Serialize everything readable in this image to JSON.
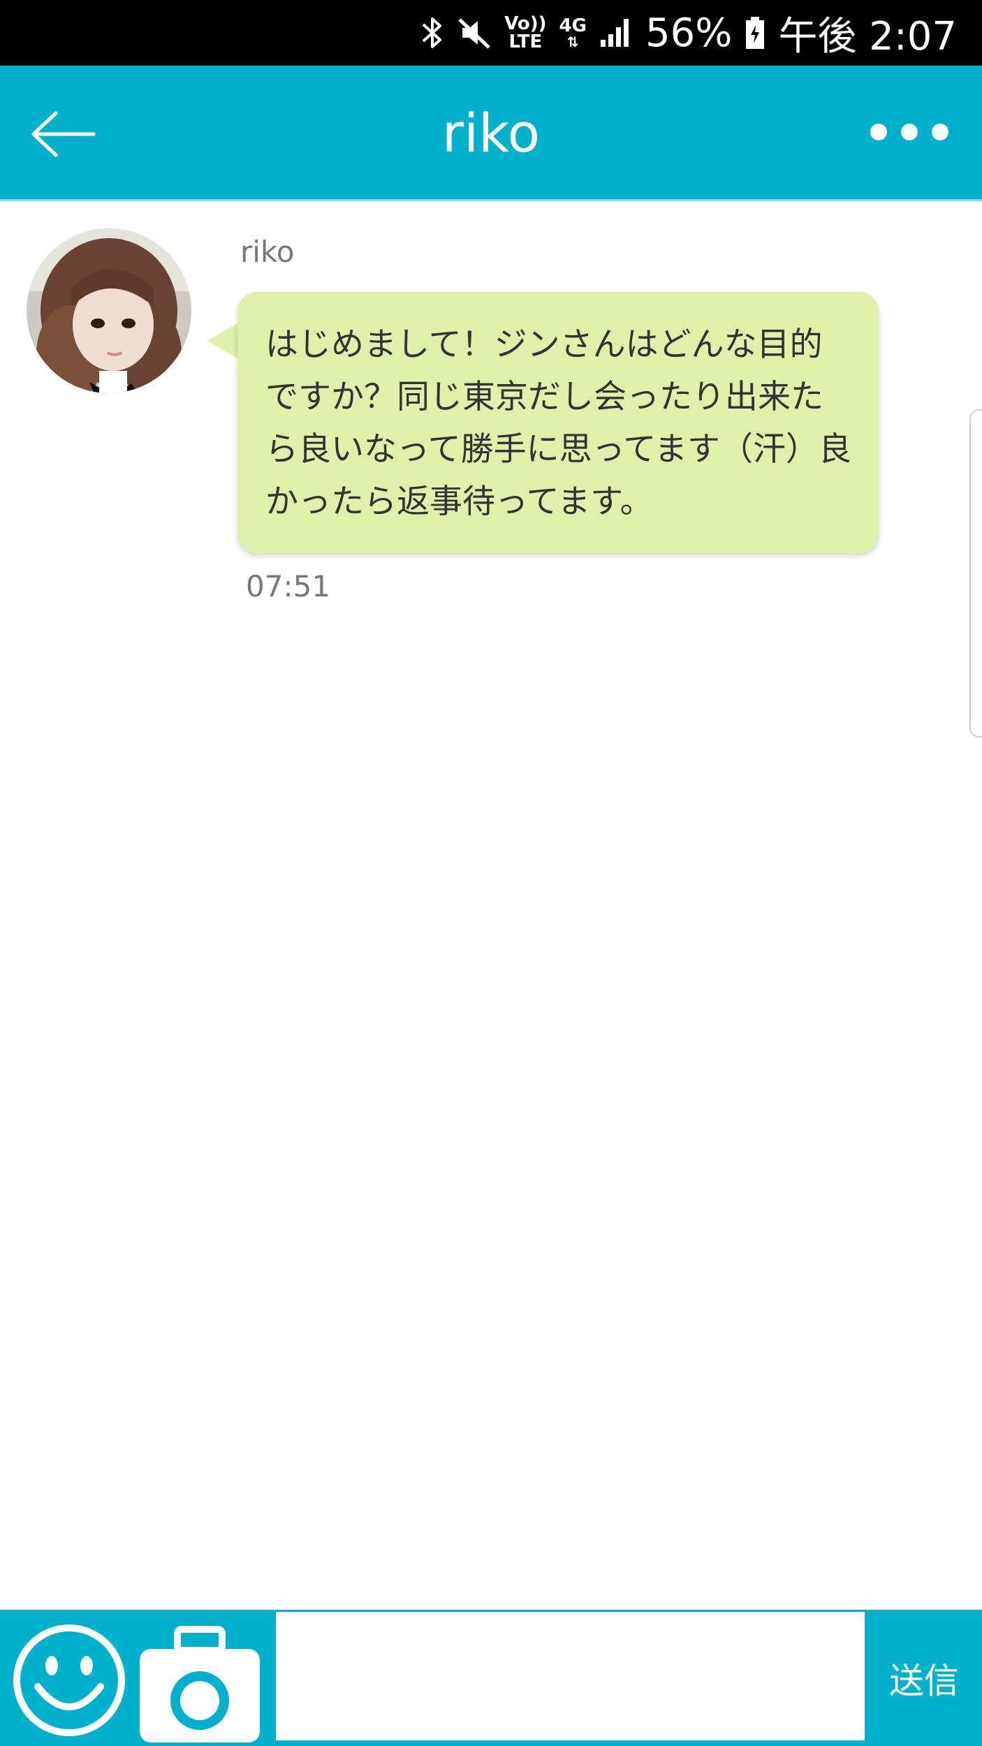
{
  "status_bar": {
    "volte_label": "Vo))",
    "lte_label": "LTE",
    "network_label": "4G",
    "battery": "56%",
    "time": "午後 2:07"
  },
  "header": {
    "title": "riko"
  },
  "messages": [
    {
      "sender": "riko",
      "text": "はじめまして！ジンさんはどんな目的ですか？同じ東京だし会ったり出来たら良いなって勝手に思ってます（汗）良かったら返事待ってます。",
      "time": "07:51"
    }
  ],
  "composer": {
    "input_value": "",
    "send_label": "送信"
  },
  "colors": {
    "accent": "#00b0cc",
    "bubble": "#dff0ab"
  }
}
